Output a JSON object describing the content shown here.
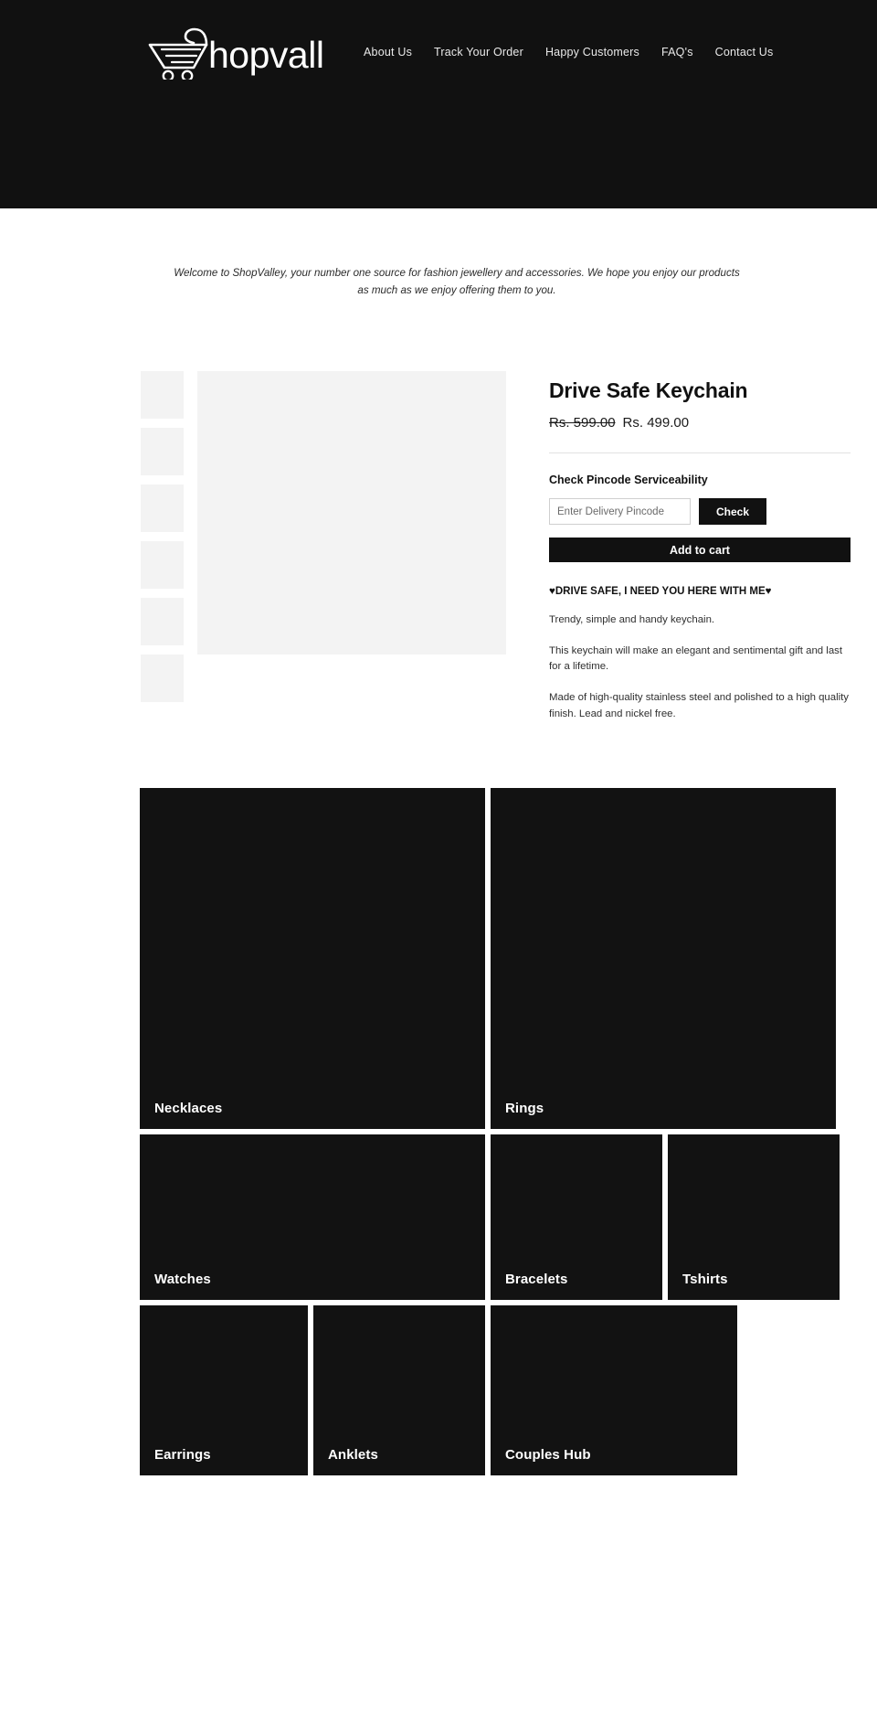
{
  "header": {
    "logo_text": "Shopvalley",
    "logo_icon": "shopping-cart-icon",
    "nav": [
      {
        "label": "About Us"
      },
      {
        "label": "Track Your Order"
      },
      {
        "label": "Happy Customers"
      },
      {
        "label": "FAQ's"
      },
      {
        "label": "Contact Us"
      }
    ]
  },
  "welcome": {
    "text": "Welcome to ShopValley, your number one source for fashion jewellery and accessories. We hope you enjoy our products as much as we enjoy offering them to you."
  },
  "product": {
    "title": "Drive Safe Keychain",
    "price_old": "Rs. 599.00",
    "price_new": "Rs. 499.00",
    "pincode_heading": "Check Pincode Serviceability",
    "pincode_placeholder": "Enter Delivery Pincode",
    "pincode_value": "",
    "check_label": "Check",
    "add_to_cart_label": "Add to cart",
    "desc_heading": "♥DRIVE SAFE, I NEED YOU HERE WITH ME♥",
    "desc_p1": "Trendy, simple and handy keychain.",
    "desc_p2": "This keychain will make an elegant and sentimental gift and last for a lifetime.",
    "desc_p3": "Made of high-quality stainless steel and polished to a high quality finish. Lead and nickel free.",
    "thumbnails": [
      {
        "label": "thumbnail-1"
      },
      {
        "label": "thumbnail-2"
      },
      {
        "label": "thumbnail-3"
      },
      {
        "label": "thumbnail-4"
      },
      {
        "label": "thumbnail-5"
      },
      {
        "label": "thumbnail-6"
      }
    ]
  },
  "categories": {
    "row1": [
      {
        "label": "Necklaces"
      },
      {
        "label": "Rings"
      }
    ],
    "row2": [
      {
        "label": "Watches"
      },
      {
        "label": "Bracelets"
      },
      {
        "label": "Tshirts"
      }
    ],
    "row3": [
      {
        "label": "Earrings"
      },
      {
        "label": "Anklets"
      },
      {
        "label": "Couples Hub"
      }
    ]
  },
  "colors": {
    "header_bg": "#111111",
    "tile_bg": "#121212",
    "accent": "#111111",
    "page_bg": "#ffffff",
    "placeholder_gray": "#f3f3f3"
  }
}
